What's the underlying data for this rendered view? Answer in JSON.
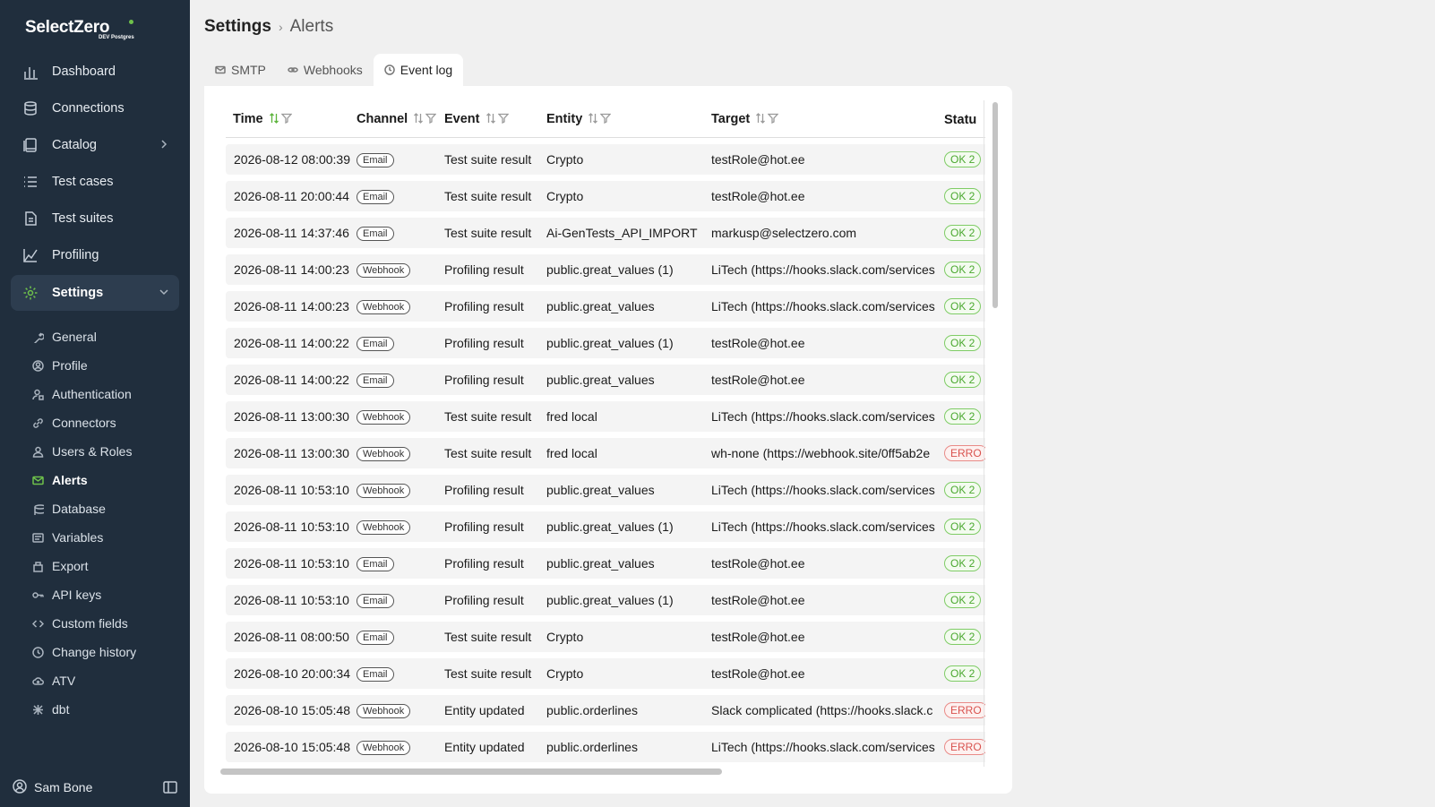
{
  "app": {
    "logo": "SelectZero",
    "logo_sub": "DEV Postgres"
  },
  "nav": [
    {
      "label": "Dashboard",
      "icon": "bar-chart-icon"
    },
    {
      "label": "Connections",
      "icon": "database-icon"
    },
    {
      "label": "Catalog",
      "icon": "book-icon"
    },
    {
      "label": "Test cases",
      "icon": "list-icon"
    },
    {
      "label": "Test suites",
      "icon": "file-icon"
    },
    {
      "label": "Profiling",
      "icon": "line-chart-icon"
    },
    {
      "label": "Settings",
      "icon": "gear-icon"
    }
  ],
  "settings_sub": [
    {
      "label": "General",
      "icon": "wrench-icon"
    },
    {
      "label": "Profile",
      "icon": "user-circle-icon"
    },
    {
      "label": "Authentication",
      "icon": "user-lock-icon"
    },
    {
      "label": "Connectors",
      "icon": "link-icon"
    },
    {
      "label": "Users & Roles",
      "icon": "user-icon"
    },
    {
      "label": "Alerts",
      "icon": "mail-icon"
    },
    {
      "label": "Database",
      "icon": "database-icon"
    },
    {
      "label": "Variables",
      "icon": "variable-icon"
    },
    {
      "label": "Export",
      "icon": "export-icon"
    },
    {
      "label": "API keys",
      "icon": "key-icon"
    },
    {
      "label": "Custom fields",
      "icon": "code-icon"
    },
    {
      "label": "Change history",
      "icon": "clock-icon"
    },
    {
      "label": "ATV",
      "icon": "cloud-icon"
    },
    {
      "label": "dbt",
      "icon": "dbt-icon"
    }
  ],
  "user": {
    "name": "Sam Bone"
  },
  "breadcrumb": {
    "section": "Settings",
    "page": "Alerts"
  },
  "tabs": [
    {
      "label": "SMTP",
      "icon": "mail-icon"
    },
    {
      "label": "Webhooks",
      "icon": "link-icon"
    },
    {
      "label": "Event log",
      "icon": "clock-icon"
    }
  ],
  "table": {
    "columns": [
      "Time",
      "Channel",
      "Event",
      "Entity",
      "Target",
      "Statu"
    ],
    "rows": [
      [
        "2026-08-12 08:00:39",
        "Email",
        "Test suite result",
        "Crypto",
        "testRole@hot.ee",
        "OK 2",
        "ok"
      ],
      [
        "2026-08-11 20:00:44",
        "Email",
        "Test suite result",
        "Crypto",
        "testRole@hot.ee",
        "OK 2",
        "ok"
      ],
      [
        "2026-08-11 14:37:46",
        "Email",
        "Test suite result",
        "Ai-GenTests_API_IMPORT",
        "markusp@selectzero.com",
        "OK 2",
        "ok"
      ],
      [
        "2026-08-11 14:00:23",
        "Webhook",
        "Profiling result",
        "public.great_values (1)",
        "LiTech (https://hooks.slack.com/services",
        "OK 2",
        "ok"
      ],
      [
        "2026-08-11 14:00:23",
        "Webhook",
        "Profiling result",
        "public.great_values",
        "LiTech (https://hooks.slack.com/services",
        "OK 2",
        "ok"
      ],
      [
        "2026-08-11 14:00:22",
        "Email",
        "Profiling result",
        "public.great_values (1)",
        "testRole@hot.ee",
        "OK 2",
        "ok"
      ],
      [
        "2026-08-11 14:00:22",
        "Email",
        "Profiling result",
        "public.great_values",
        "testRole@hot.ee",
        "OK 2",
        "ok"
      ],
      [
        "2026-08-11 13:00:30",
        "Webhook",
        "Test suite result",
        "fred local",
        "LiTech (https://hooks.slack.com/services",
        "OK 2",
        "ok"
      ],
      [
        "2026-08-11 13:00:30",
        "Webhook",
        "Test suite result",
        "fred local",
        "wh-none (https://webhook.site/0ff5ab2e",
        "ERRO",
        "err"
      ],
      [
        "2026-08-11 10:53:10",
        "Webhook",
        "Profiling result",
        "public.great_values",
        "LiTech (https://hooks.slack.com/services",
        "OK 2",
        "ok"
      ],
      [
        "2026-08-11 10:53:10",
        "Webhook",
        "Profiling result",
        "public.great_values (1)",
        "LiTech (https://hooks.slack.com/services",
        "OK 2",
        "ok"
      ],
      [
        "2026-08-11 10:53:10",
        "Email",
        "Profiling result",
        "public.great_values",
        "testRole@hot.ee",
        "OK 2",
        "ok"
      ],
      [
        "2026-08-11 10:53:10",
        "Email",
        "Profiling result",
        "public.great_values (1)",
        "testRole@hot.ee",
        "OK 2",
        "ok"
      ],
      [
        "2026-08-11 08:00:50",
        "Email",
        "Test suite result",
        "Crypto",
        "testRole@hot.ee",
        "OK 2",
        "ok"
      ],
      [
        "2026-08-10 20:00:34",
        "Email",
        "Test suite result",
        "Crypto",
        "testRole@hot.ee",
        "OK 2",
        "ok"
      ],
      [
        "2026-08-10 15:05:48",
        "Webhook",
        "Entity updated",
        "public.orderlines",
        "Slack complicated (https://hooks.slack.c",
        "ERRO",
        "err"
      ],
      [
        "2026-08-10 15:05:48",
        "Webhook",
        "Entity updated",
        "public.orderlines",
        "LiTech (https://hooks.slack.com/services",
        "ERRO",
        "err"
      ]
    ]
  }
}
